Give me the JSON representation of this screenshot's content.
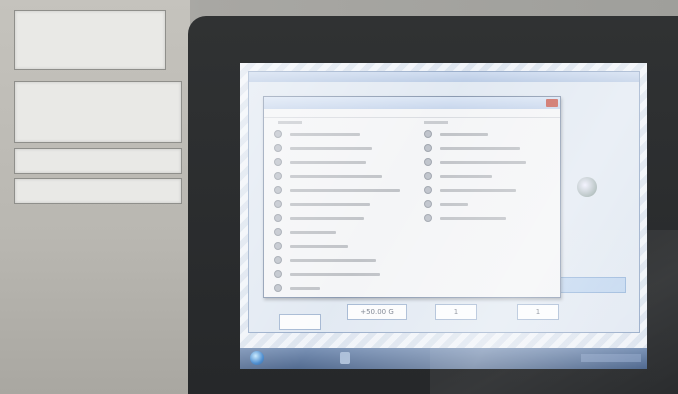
{
  "screen": {
    "fields": [
      {
        "value": "+50.00 G"
      },
      {
        "value": "1"
      },
      {
        "value": "1"
      }
    ],
    "taskbar": {
      "start_icon": "windows-start-orb-icon"
    },
    "dialog": {
      "close_icon": "close-icon"
    },
    "gauge": {
      "icon": "gauge-icon"
    }
  },
  "colors": {
    "bezel": "#2a2c2e",
    "screen_background": "#e6ecf4",
    "taskbar": "#4f6a93",
    "dialog_close": "#c65a4f"
  }
}
